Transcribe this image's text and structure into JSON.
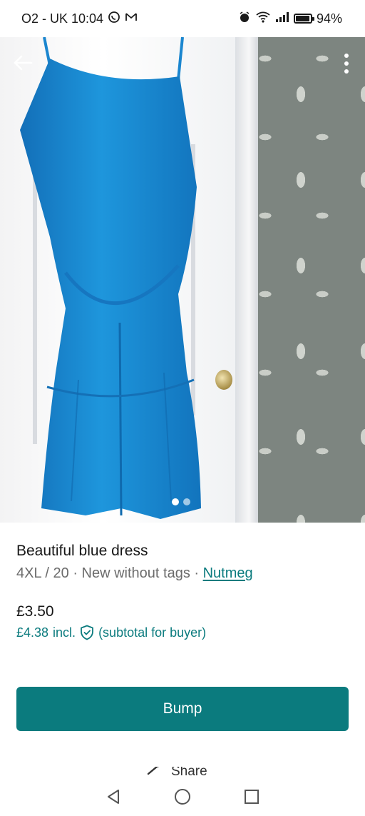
{
  "status_bar": {
    "carrier_time": "O2 - UK 10:04",
    "battery_percent": "94%",
    "battery_level": 0.94,
    "left_icons": [
      "whatsapp-icon",
      "gmail-icon"
    ],
    "right_icons": [
      "alarm-icon",
      "wifi-icon",
      "signal-icon",
      "battery-icon"
    ]
  },
  "photo": {
    "slide_count": 2,
    "active_slide": 1
  },
  "item": {
    "title": "Beautiful blue dress",
    "meta": "4XL / 20 · New without tags · ",
    "brand": "Nutmeg"
  },
  "pricing": {
    "price": "£3.50",
    "buyer_price": "£4.38",
    "incl_label": "incl.",
    "subtotal_note": "(subtotal for buyer)"
  },
  "actions": {
    "bump_label": "Bump",
    "share_label": "Share"
  },
  "colors": {
    "accent": "#0b7b7e",
    "dress": "#1c8fd6"
  }
}
